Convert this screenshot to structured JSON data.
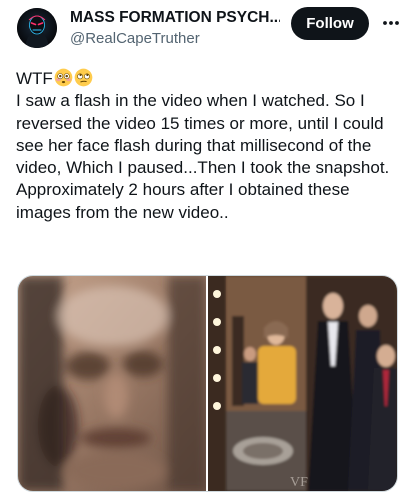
{
  "author": {
    "display_name": "MASS FORMATION PSYCH...",
    "handle": "@RealCapeTruther",
    "avatar_icon": "masked-figure-avatar"
  },
  "actions": {
    "follow_label": "Follow",
    "more_icon": "more-horizontal-icon"
  },
  "tweet": {
    "line1_text": "WTF",
    "line1_emojis": [
      "flushed-face-emoji",
      "face-with-rolling-eyes-emoji"
    ],
    "body": "I saw a flash in the video when I watched. So I reversed the video 15 times or more, until I could see her face flash during that millisecond of the video, Which I paused...Then I took the snapshot.\nApproximately 2 hours after I obtained these images from the new video..",
    "media_watermark": "VF"
  },
  "colors": {
    "text_primary": "#0f1419",
    "text_secondary": "#536471",
    "follow_bg": "#0f1419",
    "follow_text": "#ffffff",
    "border": "#cfd9de"
  }
}
